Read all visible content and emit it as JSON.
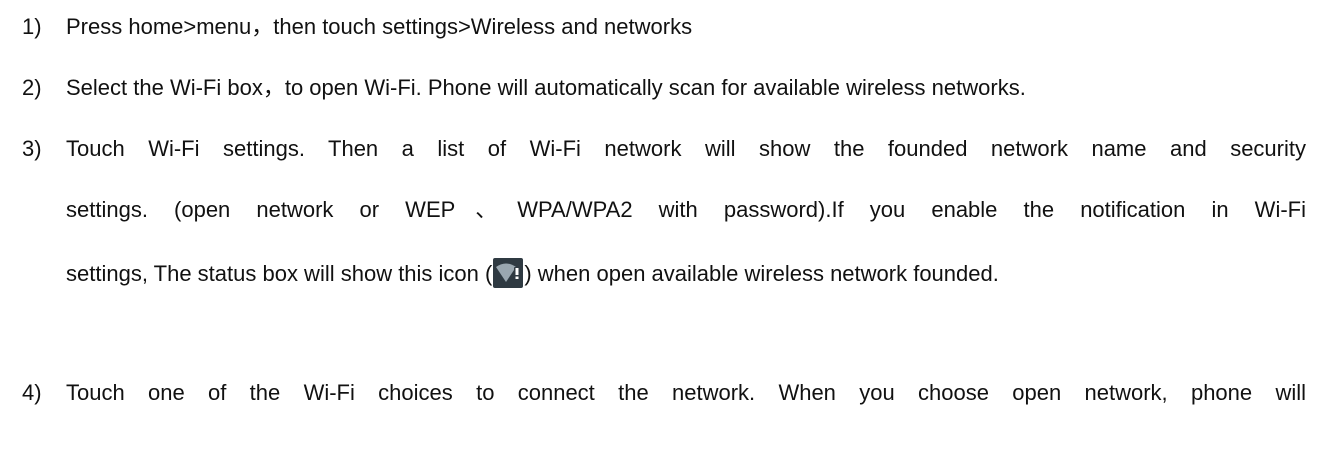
{
  "steps": [
    {
      "number": "1)",
      "lines": [
        "Press home>menu，then touch settings>Wireless and networks"
      ]
    },
    {
      "number": "2)",
      "lines": [
        "Select the Wi-Fi box，to open Wi-Fi. Phone will automatically scan for available wireless networks."
      ]
    },
    {
      "number": "3)",
      "lines": [
        "Touch Wi-Fi settings. Then a list of Wi-Fi network will show the founded network name and security",
        "settings. (open network or WEP、WPA/WPA2 with password).If you enable the notification in Wi-Fi",
        "settings, The status box will show this icon (",
        ") when open available wireless network founded."
      ]
    },
    {
      "number": "4)",
      "lines": [
        "Touch one of the Wi-Fi choices to connect the network. When you choose open network, phone will"
      ]
    }
  ],
  "icons": {
    "inline_icon": "wifi-notification-icon",
    "icon_bg_color": "#2f3a42",
    "icon_wedge_color": "#9aa7b0",
    "icon_badge_color": "#ffffff"
  }
}
